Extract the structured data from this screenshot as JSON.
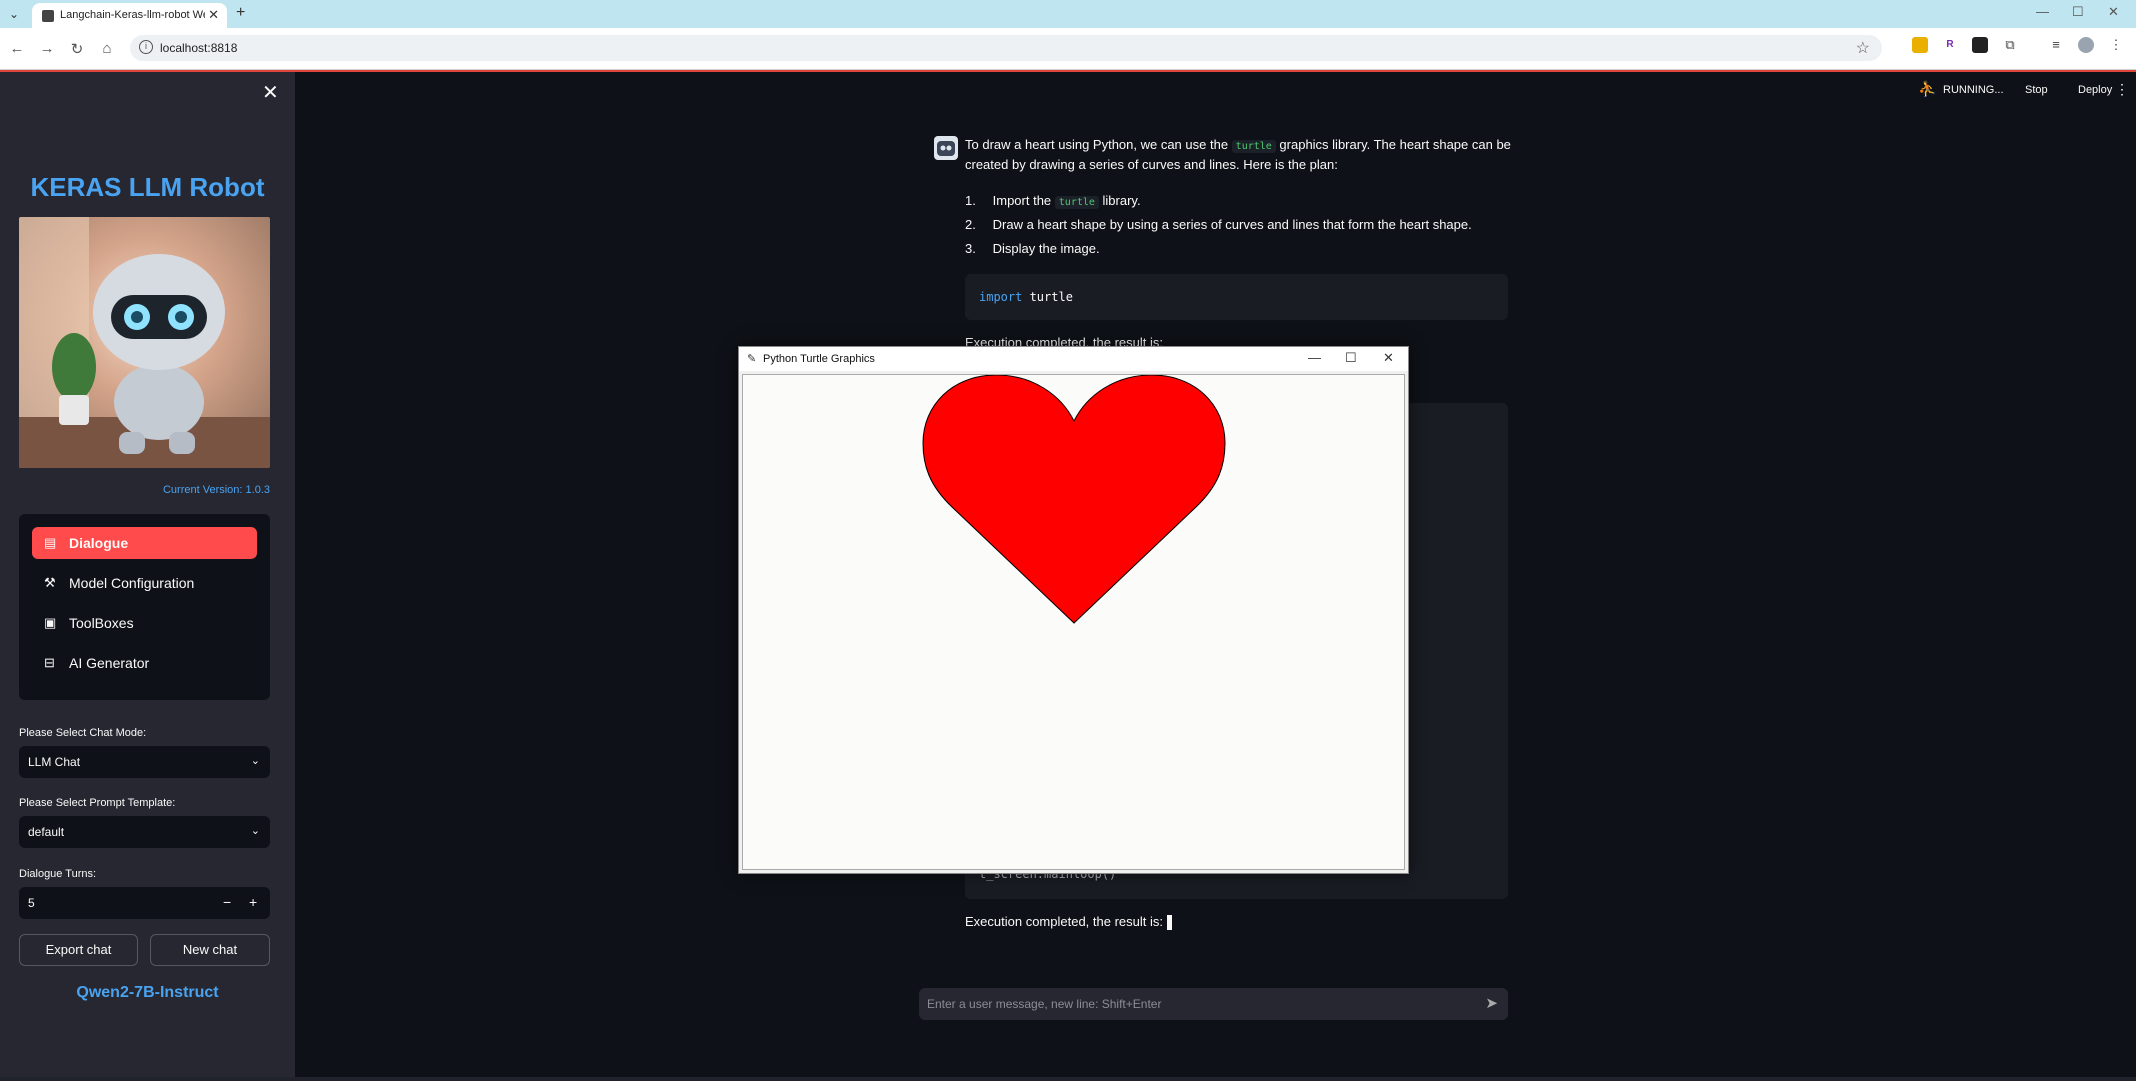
{
  "browser": {
    "tab_title": "Langchain-Keras-llm-robot We",
    "tab_close": "✕",
    "new_tab": "+",
    "url": "localhost:8818"
  },
  "sidebar": {
    "brand": "KERAS LLM Robot",
    "version": "Current Version: 1.0.3",
    "nav": [
      {
        "label": "Dialogue",
        "icon": "chat-icon"
      },
      {
        "label": "Model Configuration",
        "icon": "wand-icon"
      },
      {
        "label": "ToolBoxes",
        "icon": "archive-icon"
      },
      {
        "label": "AI Generator",
        "icon": "robot-icon"
      }
    ],
    "chat_mode_label": "Please Select Chat Mode:",
    "chat_mode_value": "LLM Chat",
    "prompt_label": "Please Select Prompt Template:",
    "prompt_value": "default",
    "turns_label": "Dialogue Turns:",
    "turns_value": "5",
    "minus": "−",
    "plus": "+",
    "export_label": "Export chat",
    "new_chat_label": "New chat",
    "model_name": "Qwen2-7B-Instruct"
  },
  "header": {
    "status": "RUNNING...",
    "stop": "Stop",
    "deploy": "Deploy",
    "menu": "⋮"
  },
  "chat": {
    "intro_1": "To draw a heart using Python, we can use the",
    "intro_code": "turtle",
    "intro_2": "graphics library. The heart shape can be",
    "intro_3": "created by drawing a series of curves and lines. Here is the plan:",
    "steps": [
      {
        "num": "1.",
        "pre": "Import the",
        "code": "turtle",
        "post": "library."
      },
      {
        "num": "2.",
        "text": "Draw a heart shape by using a series of curves and lines that form the heart shape."
      },
      {
        "num": "3.",
        "text": "Display the image."
      }
    ],
    "code1_kw": "import",
    "code1_rest": " turtle",
    "exec1": "Execution completed, the result is:",
    "code2_tail": "t_screen.mainloop()",
    "exec2": "Execution completed, the result is:",
    "input_placeholder": "Enter a user message, new line: Shift+Enter"
  },
  "turtle_window": {
    "title": "Python Turtle Graphics",
    "heart_color": "#ff0000"
  }
}
